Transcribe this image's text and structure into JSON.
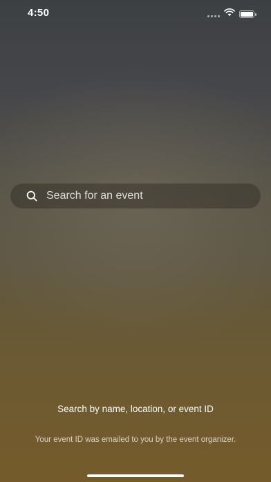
{
  "status_bar": {
    "time": "4:50",
    "icons": [
      "signal-icon",
      "wifi-icon",
      "battery-icon"
    ]
  },
  "search": {
    "placeholder": "Search for an event",
    "value": "",
    "icon": "search-icon"
  },
  "hint": {
    "title": "Search by name, location, or event ID",
    "subtitle": "Your event ID was emailed to you by the event organizer."
  },
  "colors": {
    "background_top": "#3d4042",
    "background_bottom": "#755b2b",
    "text": "#ffffff"
  }
}
